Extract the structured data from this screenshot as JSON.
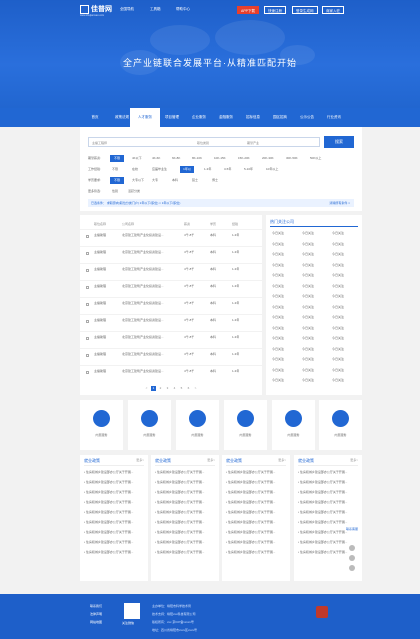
{
  "header": {
    "logo_text": "佳普网",
    "logo_sub": "www.shujiamsan.com",
    "nav": [
      "全国导航",
      "工具箱",
      "帮助中心"
    ],
    "buttons": {
      "app": "APP下载",
      "login": "快速注册",
      "employer": "登录生成网",
      "join": "商家入驻"
    }
  },
  "hero": {
    "slogan": "全产业链联合发展平台·从精准匹配开始"
  },
  "mainnav": {
    "items": [
      "首页",
      "政策法规",
      "人才服务",
      "项目管理",
      "企业服务",
      "金融服务",
      "招标信息",
      "园区招商",
      "公示公告",
      "行业资讯"
    ],
    "active_index": 2
  },
  "search": {
    "keyword": "主播工程师",
    "select1": "职位类别",
    "select2": "期望产业",
    "button": "搜索",
    "filters": [
      {
        "label": "期望薪资:",
        "options": [
          "不限",
          "4K以下",
          "4K-6K",
          "6K-8K",
          "8K-10K",
          "10K-15K",
          "15K-20K",
          "20K-30K",
          "30K-50K",
          "50K以上"
        ],
        "active": 0
      },
      {
        "label": "工作经验:",
        "options": [
          "不限",
          "在校",
          "应届毕业生",
          "1年以下",
          "1-3年",
          "3-5年",
          "5-10年",
          "10年以上"
        ],
        "active": 3
      },
      {
        "label": "学历要求:",
        "options": [
          "不限",
          "大专以下",
          "大专",
          "本科",
          "硕士",
          "博士"
        ],
        "active": 0
      },
      {
        "label": "更多筛选:",
        "options": [
          "性别",
          "活跃分类"
        ],
        "active": -1
      }
    ],
    "condition_text": "已选条件：  求职意向(职位分类门户)  1年以下(职位) × 1年以下(职位)",
    "clear": "清除所有条件 ×"
  },
  "list": {
    "headers": [
      "职位名称",
      "公司名称",
      "薪资",
      "学历",
      "经验"
    ],
    "rows": [
      {
        "name": "主播助理",
        "company": "北京建工建筑产业化投资建设...",
        "salary": "4千-8千",
        "edu": "本科",
        "exp": "1-3年"
      },
      {
        "name": "主播助理",
        "company": "北京建工建筑产业化投资建设...",
        "salary": "4千-8千",
        "edu": "本科",
        "exp": "1-3年"
      },
      {
        "name": "主播助理",
        "company": "北京建工建筑产业化投资建设...",
        "salary": "4千-8千",
        "edu": "本科",
        "exp": "1-3年"
      },
      {
        "name": "主播助理",
        "company": "北京建工建筑产业化投资建设...",
        "salary": "4千-8千",
        "edu": "本科",
        "exp": "1-3年"
      },
      {
        "name": "主播助理",
        "company": "北京建工建筑产业化投资建设...",
        "salary": "4千-8千",
        "edu": "本科",
        "exp": "1-3年"
      },
      {
        "name": "主播助理",
        "company": "北京建工建筑产业化投资建设...",
        "salary": "4千-8千",
        "edu": "本科",
        "exp": "1-3年"
      },
      {
        "name": "主播助理",
        "company": "北京建工建筑产业化投资建设...",
        "salary": "4千-8千",
        "edu": "本科",
        "exp": "1-3年"
      },
      {
        "name": "主播助理",
        "company": "北京建工建筑产业化投资建设...",
        "salary": "4千-8千",
        "edu": "本科",
        "exp": "1-3年"
      },
      {
        "name": "主播助理",
        "company": "北京建工建筑产业化投资建设...",
        "salary": "4千-8千",
        "edu": "本科",
        "exp": "1-3年"
      }
    ],
    "pages": [
      "<",
      "1",
      "2",
      "3",
      "4",
      "5",
      "6",
      ">"
    ],
    "active_page": 1
  },
  "sidebar": {
    "title": "热门关注公司",
    "items": [
      "今日关注",
      "今日关注",
      "今日关注",
      "今日关注",
      "今日关注",
      "今日关注",
      "今日关注",
      "今日关注",
      "今日关注",
      "今日关注",
      "今日关注",
      "今日关注",
      "今日关注",
      "今日关注",
      "今日关注",
      "今日关注",
      "今日关注",
      "今日关注",
      "今日关注",
      "今日关注",
      "今日关注",
      "今日关注",
      "今日关注",
      "今日关注",
      "今日关注",
      "今日关注",
      "今日关注",
      "今日关注",
      "今日关注",
      "今日关注",
      "今日关注",
      "今日关注",
      "今日关注",
      "今日关注",
      "今日关注",
      "今日关注",
      "今日关注",
      "今日关注",
      "今日关注",
      "今日关注",
      "今日关注",
      "今日关注",
      "今日关注",
      "今日关注",
      "今日关注"
    ]
  },
  "tiles": {
    "items": [
      "内页服务",
      "内页服务",
      "内页服务",
      "内页服务",
      "内页服务",
      "内页服务"
    ]
  },
  "policies": {
    "title": "就业政策",
    "more": "更多>",
    "items": [
      "• 住房和城乡建设部办公厅关于开展...",
      "• 住房和城乡建设部办公厅关于开展...",
      "• 住房和城乡建设部办公厅关于开展...",
      "• 住房和城乡建设部办公厅关于开展...",
      "• 住房和城乡建设部办公厅关于开展...",
      "• 住房和城乡建设部办公厅关于开展...",
      "• 住房和城乡建设部办公厅关于开展...",
      "• 住房和城乡建设部办公厅关于开展...",
      "• 住房和城乡建设部办公厅关于开展..."
    ]
  },
  "float": {
    "label": "联系客服"
  },
  "footer": {
    "links": [
      "联系我们",
      "法律声明",
      "网站地图"
    ],
    "qr_label": "关注微信",
    "info": [
      "主办单位：绵阳市科学技术局",
      "技术支持：绵阳xxx科技有限公司",
      "版权所有：xxx 京ICP备xxxxx号",
      "地址：四川省绵阳市xxxx区xxxx号"
    ]
  },
  "colors": {
    "primary": "#2167d3",
    "accent": "#e8402d",
    "bg": "#f2f2f2"
  }
}
